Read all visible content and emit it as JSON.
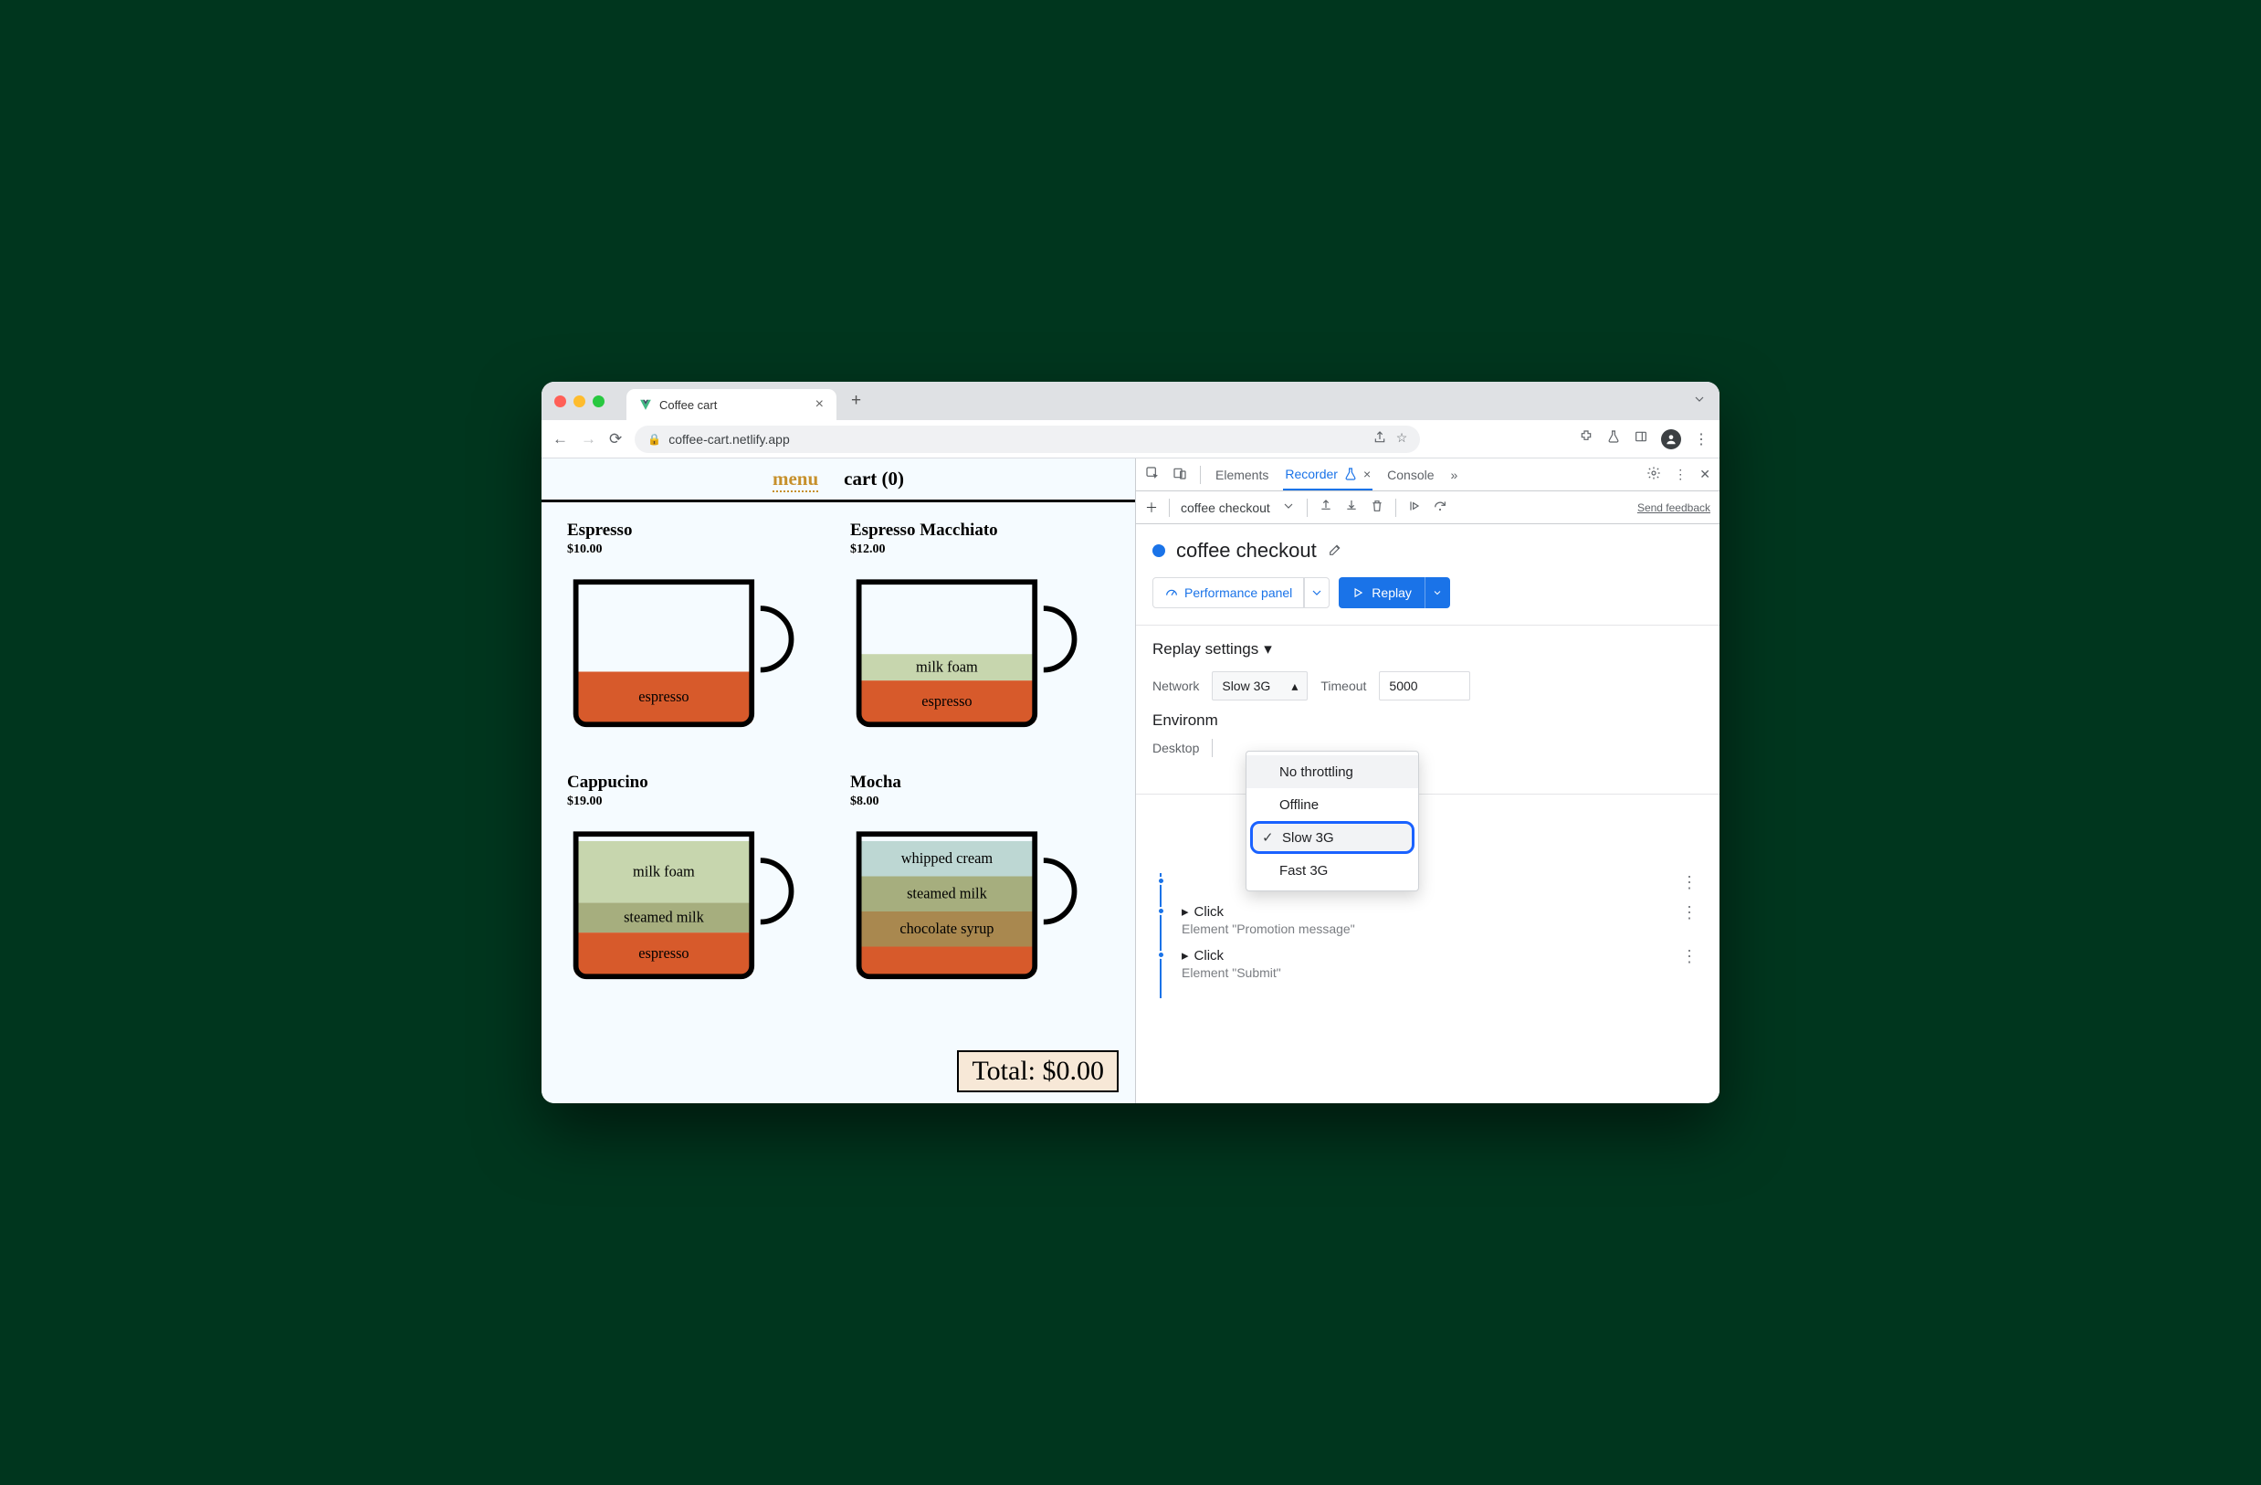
{
  "browser": {
    "tab_title": "Coffee cart",
    "url": "coffee-cart.netlify.app"
  },
  "site": {
    "nav_menu": "menu",
    "nav_cart": "cart (0)",
    "products": [
      {
        "name": "Espresso",
        "price": "$10.00",
        "layers": [
          {
            "label": "espresso",
            "color": "#d75a2b",
            "h": 58
          }
        ]
      },
      {
        "name": "Espresso Macchiato",
        "price": "$12.00",
        "layers": [
          {
            "label": "milk foam",
            "color": "#c7d6ae",
            "h": 30
          },
          {
            "label": "espresso",
            "color": "#d75a2b",
            "h": 48
          }
        ]
      },
      {
        "name": "Cappucino",
        "price": "$19.00",
        "layers": [
          {
            "label": "milk foam",
            "color": "#c7d6ae",
            "h": 70
          },
          {
            "label": "steamed milk",
            "color": "#a6ae7e",
            "h": 34
          },
          {
            "label": "espresso",
            "color": "#d75a2b",
            "h": 48
          }
        ]
      },
      {
        "name": "Mocha",
        "price": "$8.00",
        "layers": [
          {
            "label": "whipped cream",
            "color": "#bdd7d3",
            "h": 40
          },
          {
            "label": "steamed milk",
            "color": "#a6ae7e",
            "h": 40
          },
          {
            "label": "chocolate syrup",
            "color": "#a9884f",
            "h": 40
          },
          {
            "label": "",
            "color": "#d75a2b",
            "h": 32
          }
        ]
      }
    ],
    "total_label": "Total: $0.00"
  },
  "devtools": {
    "tabs": {
      "elements": "Elements",
      "recorder": "Recorder",
      "console": "Console",
      "more": "»"
    },
    "recording_name": "coffee checkout",
    "title": "coffee checkout",
    "feedback": "Send feedback",
    "perf_button": "Performance panel",
    "replay_button": "Replay",
    "replay_settings_title": "Replay settings",
    "network_label": "Network",
    "network_value": "Slow 3G",
    "timeout_label": "Timeout",
    "timeout_value": "5000",
    "env_title": "Environm",
    "env_device": "Desktop",
    "dropdown_options": [
      "No throttling",
      "Offline",
      "Slow 3G",
      "Fast 3G"
    ],
    "steps": [
      {
        "title": "Click",
        "sub": "Element \"Promotion message\""
      },
      {
        "title": "Click",
        "sub": "Element \"Submit\""
      }
    ]
  }
}
